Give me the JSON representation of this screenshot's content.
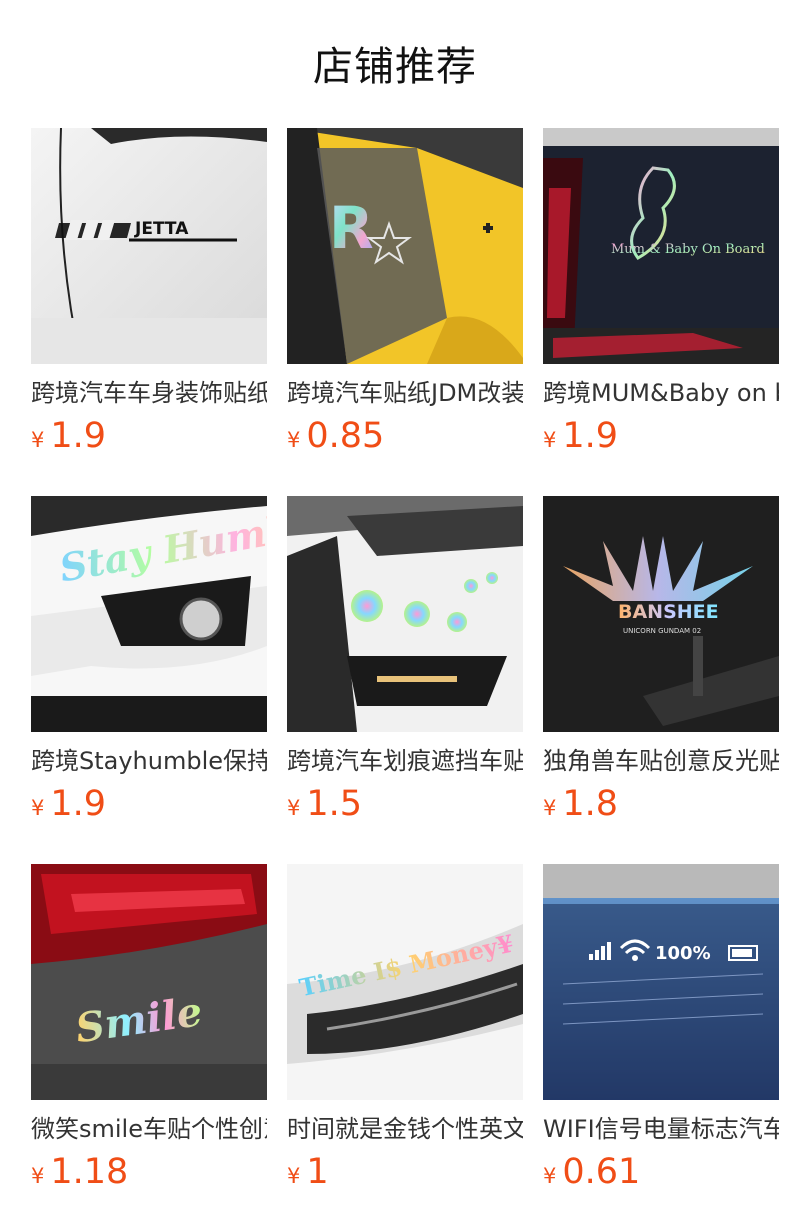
{
  "header": {
    "title": "店铺推荐"
  },
  "products": [
    {
      "name": "跨境汽车车身装饰贴纸",
      "price": "1.9",
      "currency": "¥",
      "sticker_text": "JETTA"
    },
    {
      "name": "跨境汽车贴纸JDM改装",
      "price": "0.85",
      "currency": "¥",
      "sticker_text": "R"
    },
    {
      "name": "跨境MUM&Baby on board",
      "price": "1.9",
      "currency": "¥",
      "sticker_text": "Mum & Baby On Board"
    },
    {
      "name": "跨境Stayhumble保持谦逊",
      "price": "1.9",
      "currency": "¥",
      "sticker_text": "Stay Humble"
    },
    {
      "name": "跨境汽车划痕遮挡车贴",
      "price": "1.5",
      "currency": "¥",
      "sticker_text": ""
    },
    {
      "name": "独角兽车贴创意反光贴",
      "price": "1.8",
      "currency": "¥",
      "sticker_text": "BANSHEE",
      "sticker_subtext": "UNICORN GUNDAM 02"
    },
    {
      "name": "微笑smile车贴个性创意",
      "price": "1.18",
      "currency": "¥",
      "sticker_text": "Smile"
    },
    {
      "name": "时间就是金钱个性英文",
      "price": "1",
      "currency": "¥",
      "sticker_text": "Time I$ Money¥"
    },
    {
      "name": "WIFI信号电量标志汽车贴",
      "price": "0.61",
      "currency": "¥",
      "sticker_text": "100%"
    }
  ],
  "colors": {
    "price": "#f04d16",
    "title": "#111111",
    "name": "#333333"
  }
}
